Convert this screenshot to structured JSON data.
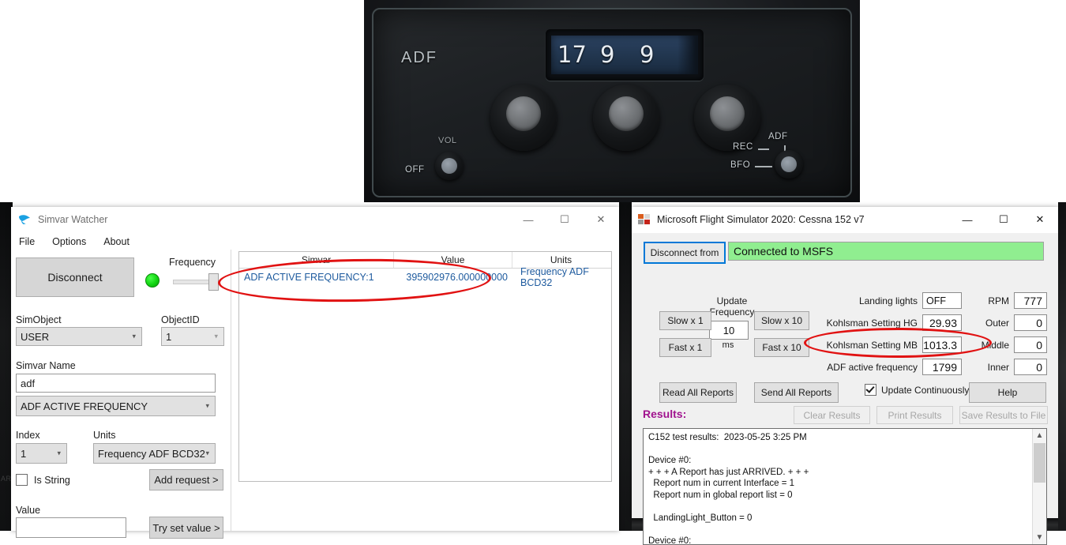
{
  "adf_panel": {
    "label": "ADF",
    "readout_digits": [
      "17",
      "9",
      "9"
    ],
    "vol_label": "VOL",
    "off_label": "OFF",
    "rec_label": "REC",
    "adf_mode_label": "ADF",
    "bfo_label": "BFO"
  },
  "desktop": {
    "ghost_text": "AR"
  },
  "simvar_window": {
    "title": "Simvar Watcher",
    "icon": "bird-icon",
    "controls": {
      "minimize": "—",
      "maximize": "☐",
      "close": "✕"
    },
    "menu": [
      "File",
      "Options",
      "About"
    ],
    "disconnect_label": "Disconnect",
    "led": "connected-green",
    "frequency_label": "Frequency",
    "simobject_label": "SimObject",
    "simobject_value": "USER",
    "objectid_label": "ObjectID",
    "objectid_value": "1",
    "simvar_name_label": "Simvar Name",
    "simvar_name_value": "adf",
    "simvar_select_value": "ADF ACTIVE FREQUENCY",
    "index_label": "Index",
    "index_value": "1",
    "units_label": "Units",
    "units_value": "Frequency ADF BCD32",
    "is_string_label": "Is String",
    "is_string_checked": false,
    "add_request_label": "Add request >",
    "value_label": "Value",
    "value_input": "",
    "try_set_value_label": "Try set value >",
    "table": {
      "columns": [
        "Simvar",
        "Value",
        "Units"
      ],
      "rows": [
        [
          "ADF ACTIVE FREQUENCY:1",
          "395902976.000000000",
          "Frequency ADF BCD32"
        ]
      ]
    }
  },
  "msfs_window": {
    "title": "Microsoft Flight Simulator 2020: Cessna 152 v7",
    "icon": "app-icon",
    "controls": {
      "minimize": "—",
      "maximize": "☐",
      "close": "✕"
    },
    "disconnect_from_label": "Disconnect from",
    "connection_status": "Connected to MSFS",
    "connection_status_color": "#90ee90",
    "update_frequency_label": "Update\nFrequency",
    "update_frequency_value": "10",
    "ms_label": "ms",
    "speed_buttons": [
      "Slow x 1",
      "Fast x 1",
      "Slow x 10",
      "Fast x 10"
    ],
    "readouts_left": [
      {
        "label": "Landing lights",
        "value": "OFF",
        "align": "left"
      },
      {
        "label": "Kohlsman Setting HG",
        "value": "29.93",
        "align": "right"
      },
      {
        "label": "Kohlsman Setting MB",
        "value": "1013.3",
        "align": "right"
      },
      {
        "label": "ADF active frequency",
        "value": "1799",
        "align": "right"
      }
    ],
    "readouts_right": [
      {
        "label": "RPM",
        "value": "777"
      },
      {
        "label": "Outer",
        "value": "0"
      },
      {
        "label": "Middle",
        "value": "0"
      },
      {
        "label": "Inner",
        "value": "0"
      }
    ],
    "read_all_reports_label": "Read All Reports",
    "send_all_reports_label": "Send All Reports",
    "update_continuously_label": "Update Continuously",
    "update_continuously_checked": true,
    "help_label": "Help",
    "results_label": "Results:",
    "results_label_color": "#a0138e",
    "clear_results_label": "Clear Results",
    "print_results_label": "Print Results",
    "save_results_label": "Save Results to File",
    "results_text": "C152 test results:  2023-05-25 3:25 PM\n\nDevice #0:\n+ + + A Report has just ARRIVED. + + +\n  Report num in current Interface = 1\n  Report num in global report list = 0\n\n  LandingLight_Button = 0\n\nDevice #0:"
  },
  "annotations": {
    "accent_color": "#e11212",
    "ellipse_table_row": "highlights ADF ACTIVE FREQUENCY row",
    "ellipse_adf_freq": "highlights ADF active frequency 1799"
  }
}
